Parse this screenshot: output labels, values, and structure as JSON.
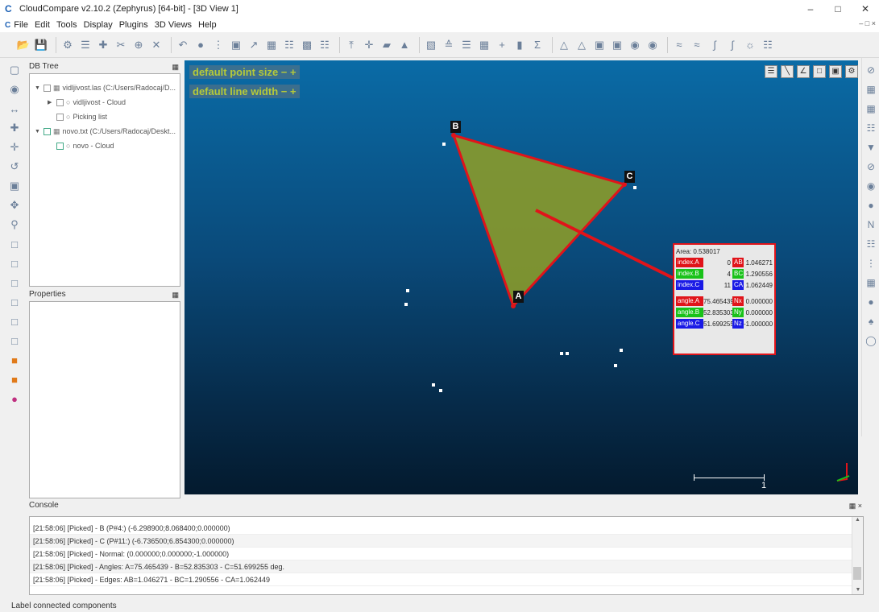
{
  "window": {
    "title": "CloudCompare v2.10.2 (Zephyrus) [64-bit] - [3D View 1]",
    "app_icon": "C"
  },
  "menu": {
    "items": [
      "File",
      "Edit",
      "Tools",
      "Display",
      "Plugins",
      "3D Views",
      "Help"
    ]
  },
  "panels": {
    "dbtree_title": "DB Tree",
    "properties_title": "Properties",
    "console_title": "Console"
  },
  "tree": [
    {
      "label": "vidljivost.las (C:/Users/Radocaj/D...",
      "level": 0
    },
    {
      "label": "vidljivost - Cloud",
      "level": 1
    },
    {
      "label": "Picking list",
      "level": 1
    },
    {
      "label": "novo.txt (C:/Users/Radocaj/Deskt...",
      "level": 0
    },
    {
      "label": "novo - Cloud",
      "level": 1
    }
  ],
  "overlay": {
    "point_size": "default point size  −  +",
    "line_width": "default line width  −  +"
  },
  "points": {
    "a": "A",
    "b": "B",
    "c": "C"
  },
  "label_box": {
    "area": "Area: 0.538017",
    "rows1": [
      {
        "t1": "index.A",
        "v1": "0",
        "t2": "AB",
        "v2": "1.046271",
        "c1": "#e0141a",
        "c2": "#e0141a"
      },
      {
        "t1": "index.B",
        "v1": "4",
        "t2": "BC",
        "v2": "1.290556",
        "c1": "#19c219",
        "c2": "#19c219"
      },
      {
        "t1": "index.C",
        "v1": "11",
        "t2": "CA",
        "v2": "1.062449",
        "c1": "#1a1ae6",
        "c2": "#1a1ae6"
      }
    ],
    "rows2": [
      {
        "t1": "angle.A",
        "v1": "75.465439",
        "t2": "Nx",
        "v2": "0.000000",
        "c1": "#e0141a",
        "c2": "#e0141a"
      },
      {
        "t1": "angle.B",
        "v1": "52.835303",
        "t2": "Ny",
        "v2": "0.000000",
        "c1": "#19c219",
        "c2": "#19c219"
      },
      {
        "t1": "angle.C",
        "v1": "51.699255",
        "t2": "Nz",
        "v2": "-1.000000",
        "c1": "#1a1ae6",
        "c2": "#1a1ae6"
      }
    ]
  },
  "scale": {
    "label": "1"
  },
  "console_lines": [
    "[21:58:06] [Picked]        - B (P#4:) (-6.298900;8.068400;0.000000)",
    "[21:58:06] [Picked]        - C (P#11:) (-6.736500;6.854300;0.000000)",
    "[21:58:06] [Picked]        - Normal: (0.000000;0.000000;-1.000000)",
    "[21:58:06] [Picked]        - Angles: A=75.465439 - B=52.835303 - C=51.699255 deg.",
    "[21:58:06] [Picked]        - Edges: AB=1.046271 - BC=1.290556 - CA=1.062449"
  ],
  "status": "Label connected components"
}
